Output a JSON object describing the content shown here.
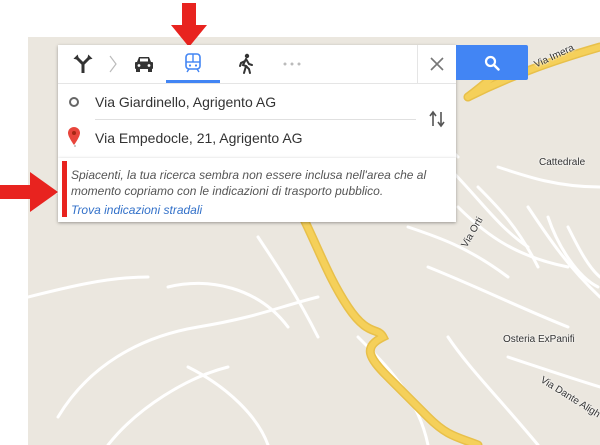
{
  "map": {
    "labels": {
      "via_imera": "Via Imera",
      "cattedrale": "Cattedrale",
      "via_orti": "Via Orti",
      "osteria": "Osteria ExPanifi",
      "via_dante": "Via Dante Aligh"
    }
  },
  "directions": {
    "modes": [
      {
        "name": "best-route",
        "icon": "route-icon"
      },
      {
        "name": "driving",
        "icon": "car-icon"
      },
      {
        "name": "transit",
        "icon": "train-icon",
        "active": true
      },
      {
        "name": "walking",
        "icon": "walk-icon"
      },
      {
        "name": "more",
        "icon": "more-icon"
      }
    ],
    "origin": "Via Giardinello, Agrigento AG",
    "destination": "Via Empedocle, 21, Agrigento AG"
  },
  "notice": {
    "message": "Spiacenti, la tua ricerca sembra non essere inclusa nell'area che al momento copriamo con le indicazioni di trasporto pubblico.",
    "link": "Trova indicazioni stradali"
  },
  "colors": {
    "accent": "#4285f4",
    "arrow_red": "#e8231f",
    "road_major": "#f5d05a",
    "link": "#3371c9"
  }
}
